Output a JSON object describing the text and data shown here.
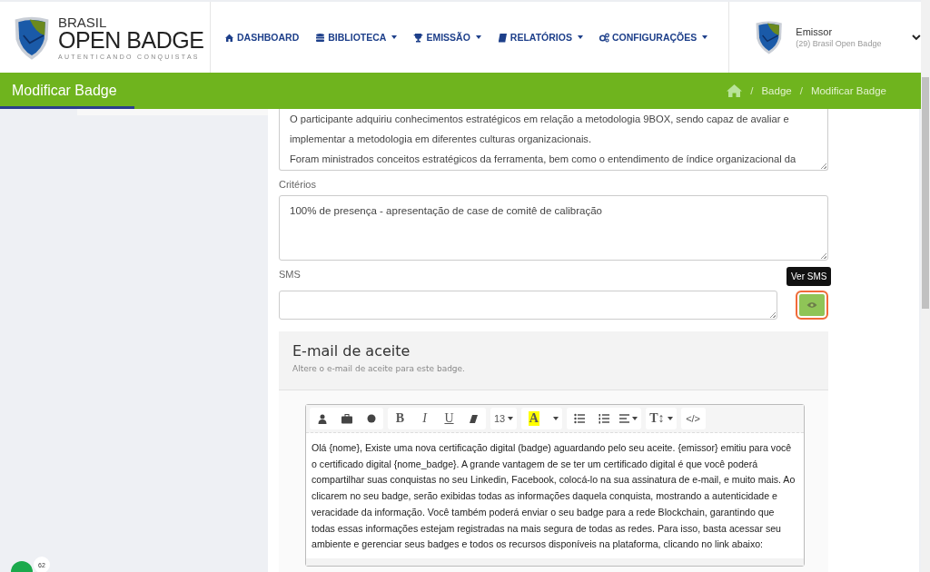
{
  "logo": {
    "top": "BRASIL",
    "main": "OPEN BADGE",
    "tagline": "AUTENTICANDO CONQUISTAS"
  },
  "nav": [
    {
      "label": "DASHBOARD",
      "kind": "home",
      "dropdown": false
    },
    {
      "label": "BIBLIOTECA",
      "kind": "database",
      "dropdown": true
    },
    {
      "label": "EMISSÃO",
      "kind": "trophy",
      "dropdown": true
    },
    {
      "label": "RELATÓRIOS",
      "kind": "book",
      "dropdown": true
    },
    {
      "label": "CONFIGURAÇÕES",
      "kind": "gears",
      "dropdown": true
    }
  ],
  "user": {
    "role": "Emissor",
    "org": "(29) Brasil Open Badge"
  },
  "page_title": "Modificar Badge",
  "breadcrumb": [
    {
      "separator": "/",
      "label": "Badge"
    },
    {
      "separator": "/",
      "label": "Modificar Badge"
    }
  ],
  "description": {
    "lines": [
      "O participante adquiriu conhecimentos estratégicos em relação a metodologia 9BOX, sendo capaz de avaliar e implementar a metodologia em diferentes culturas organizacionais.",
      "Foram ministrados conceitos estratégicos da ferramenta, bem como o entendimento de índice organizacional da"
    ]
  },
  "criteria": {
    "label": "Critérios",
    "value": "100% de presença - apresentação de case de comitê de calibração"
  },
  "sms": {
    "label": "SMS",
    "tooltip": "Ver SMS"
  },
  "email": {
    "title": "E-mail de aceite",
    "subtitle": "Altere o e-mail de aceite para este badge.",
    "toolbar": [
      [
        {
          "kind": "person"
        },
        {
          "kind": "briefcase"
        },
        {
          "kind": "dot"
        }
      ],
      [
        {
          "kind": "bold",
          "text": "B"
        },
        {
          "kind": "italic",
          "text": "I"
        },
        {
          "kind": "underline",
          "text": "U"
        },
        {
          "kind": "eraser"
        }
      ],
      [
        {
          "kind": "size",
          "text": "13",
          "dropdown": true
        }
      ],
      [
        {
          "kind": "color",
          "text": "A"
        },
        {
          "kind": "caret"
        }
      ],
      [
        {
          "kind": "bullets"
        },
        {
          "kind": "numbers"
        },
        {
          "kind": "align",
          "dropdown": true
        }
      ],
      [
        {
          "kind": "heading",
          "text": "T↕",
          "dropdown": true
        }
      ],
      [
        {
          "kind": "code",
          "text": "</>"
        }
      ]
    ],
    "body": "Olá {nome}, Existe uma nova certificação digital (badge) aguardando pelo seu aceite. {emissor} emitiu para você o certificado digital {nome_badge}. A grande vantagem de se ter um certificado digital é que você poderá compartilhar suas conquistas no seu Linkedin, Facebook, colocá-lo na sua assinatura de e-mail, e muito mais. Ao clicarem no seu badge, serão exibidas todas as informações daquela conquista, mostrando a autenticidade e veracidade da informação. Você também poderá enviar o seu badge para a rede Blockchain, garantindo que todas essas informações estejam registradas na mais segura de todas as redes. Para isso, basta acessar seu ambiente e gerenciar seus badges e todos os recursos disponíveis na plataforma, clicando no link abaixo:"
  },
  "chat_badge": "62"
}
